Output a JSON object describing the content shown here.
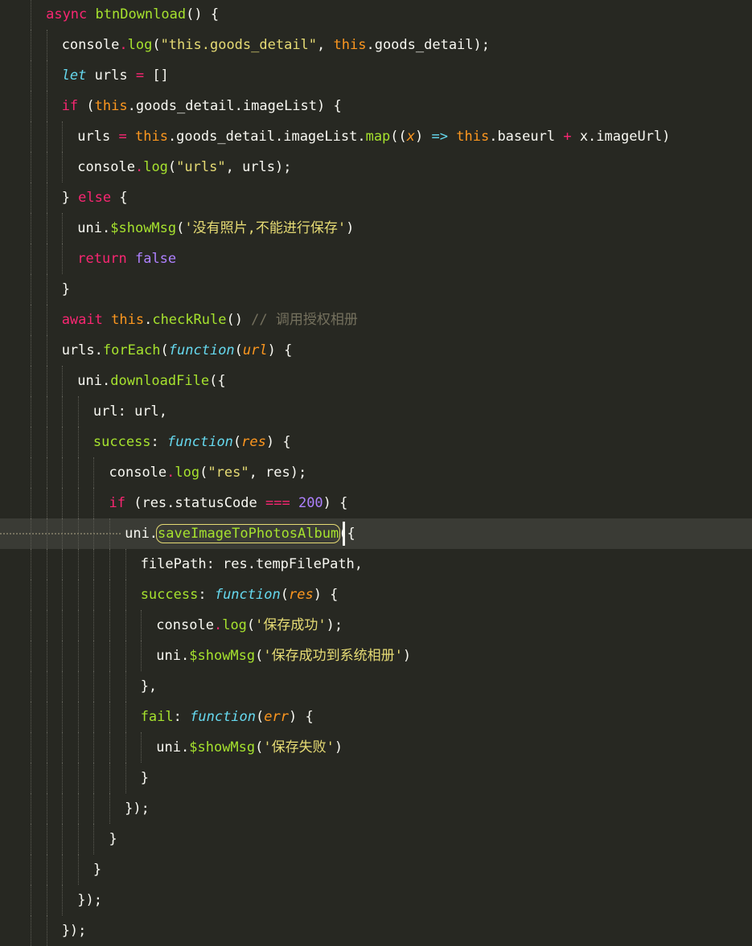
{
  "colors": {
    "background": "#272822",
    "text": "#f8f8f2",
    "keyword": "#f92672",
    "function": "#a6e22e",
    "string": "#e6db74",
    "number": "#ae81ff",
    "this": "#fd971f",
    "declaration": "#66d9ef",
    "comment": "#75715e",
    "active_line": "#3a3b35"
  },
  "active_line_index": 17,
  "highlighted_token": "saveImageToPhotosAlbum",
  "lines": [
    {
      "indent": 1,
      "tokens": [
        [
          "kw",
          "async "
        ],
        [
          "fn",
          "btnDownload"
        ],
        [
          "pl",
          "() {"
        ]
      ]
    },
    {
      "indent": 2,
      "tokens": [
        [
          "pl",
          "console"
        ],
        [
          "kw",
          "."
        ],
        [
          "fn",
          "log"
        ],
        [
          "pl",
          "("
        ],
        [
          "str",
          "\"this.goods_detail\""
        ],
        [
          "pl",
          ", "
        ],
        [
          "this",
          "this"
        ],
        [
          "pl",
          ".goods_detail);"
        ]
      ]
    },
    {
      "indent": 2,
      "tokens": [
        [
          "decl",
          "let"
        ],
        [
          "pl",
          " urls "
        ],
        [
          "kw",
          "="
        ],
        [
          "pl",
          " []"
        ]
      ]
    },
    {
      "indent": 2,
      "tokens": [
        [
          "kw",
          "if"
        ],
        [
          "pl",
          " ("
        ],
        [
          "this",
          "this"
        ],
        [
          "pl",
          ".goods_detail.imageList) {"
        ]
      ]
    },
    {
      "indent": 3,
      "tokens": [
        [
          "pl",
          "urls "
        ],
        [
          "kw",
          "="
        ],
        [
          "pl",
          " "
        ],
        [
          "this",
          "this"
        ],
        [
          "pl",
          ".goods_detail.imageList."
        ],
        [
          "fn",
          "map"
        ],
        [
          "pl",
          "(("
        ],
        [
          "param",
          "x"
        ],
        [
          "pl",
          ") "
        ],
        [
          "decl",
          "=>"
        ],
        [
          "pl",
          " "
        ],
        [
          "this",
          "this"
        ],
        [
          "pl",
          ".baseurl "
        ],
        [
          "kw",
          "+"
        ],
        [
          "pl",
          " x.imageUrl)"
        ]
      ]
    },
    {
      "indent": 3,
      "tokens": [
        [
          "pl",
          "console"
        ],
        [
          "kw",
          "."
        ],
        [
          "fn",
          "log"
        ],
        [
          "pl",
          "("
        ],
        [
          "str",
          "\"urls\""
        ],
        [
          "pl",
          ", urls);"
        ]
      ]
    },
    {
      "indent": 2,
      "tokens": [
        [
          "pl",
          "} "
        ],
        [
          "kw",
          "else"
        ],
        [
          "pl",
          " {"
        ]
      ]
    },
    {
      "indent": 3,
      "tokens": [
        [
          "pl",
          "uni."
        ],
        [
          "fn",
          "$showMsg"
        ],
        [
          "pl",
          "("
        ],
        [
          "str",
          "'没有照片,不能进行保存'"
        ],
        [
          "pl",
          ")"
        ]
      ]
    },
    {
      "indent": 3,
      "tokens": [
        [
          "kw",
          "return"
        ],
        [
          "pl",
          " "
        ],
        [
          "num",
          "false"
        ]
      ]
    },
    {
      "indent": 2,
      "tokens": [
        [
          "pl",
          "}"
        ]
      ]
    },
    {
      "indent": 2,
      "tokens": [
        [
          "kw",
          "await"
        ],
        [
          "pl",
          " "
        ],
        [
          "this",
          "this"
        ],
        [
          "pl",
          "."
        ],
        [
          "fn",
          "checkRule"
        ],
        [
          "pl",
          "() "
        ],
        [
          "cm",
          "// 调用授权相册"
        ]
      ]
    },
    {
      "indent": 2,
      "tokens": [
        [
          "pl",
          "urls."
        ],
        [
          "fn",
          "forEach"
        ],
        [
          "pl",
          "("
        ],
        [
          "decl",
          "function"
        ],
        [
          "pl",
          "("
        ],
        [
          "param",
          "url"
        ],
        [
          "pl",
          ") {"
        ]
      ]
    },
    {
      "indent": 3,
      "tokens": [
        [
          "pl",
          "uni."
        ],
        [
          "fn",
          "downloadFile"
        ],
        [
          "pl",
          "({"
        ]
      ]
    },
    {
      "indent": 4,
      "tokens": [
        [
          "pl",
          "url: url,"
        ]
      ]
    },
    {
      "indent": 4,
      "tokens": [
        [
          "fn",
          "success"
        ],
        [
          "pl",
          ": "
        ],
        [
          "decl",
          "function"
        ],
        [
          "pl",
          "("
        ],
        [
          "param",
          "res"
        ],
        [
          "pl",
          ") {"
        ]
      ]
    },
    {
      "indent": 5,
      "tokens": [
        [
          "pl",
          "console"
        ],
        [
          "kw",
          "."
        ],
        [
          "fn",
          "log"
        ],
        [
          "pl",
          "("
        ],
        [
          "str",
          "\"res\""
        ],
        [
          "pl",
          ", res);"
        ]
      ]
    },
    {
      "indent": 5,
      "tokens": [
        [
          "kw",
          "if"
        ],
        [
          "pl",
          " (res.statusCode "
        ],
        [
          "kw",
          "==="
        ],
        [
          "pl",
          " "
        ],
        [
          "num",
          "200"
        ],
        [
          "pl",
          ") {"
        ]
      ]
    },
    {
      "indent": 6,
      "tokens": [
        [
          "pl",
          "uni."
        ],
        [
          "fn",
          "saveImageToPhotosAlbum"
        ],
        [
          "pl",
          "({"
        ]
      ]
    },
    {
      "indent": 7,
      "tokens": [
        [
          "pl",
          "filePath: res.tempFilePath,"
        ]
      ]
    },
    {
      "indent": 7,
      "tokens": [
        [
          "fn",
          "success"
        ],
        [
          "pl",
          ": "
        ],
        [
          "decl",
          "function"
        ],
        [
          "pl",
          "("
        ],
        [
          "param",
          "res"
        ],
        [
          "pl",
          ") {"
        ]
      ]
    },
    {
      "indent": 8,
      "tokens": [
        [
          "pl",
          "console"
        ],
        [
          "kw",
          "."
        ],
        [
          "fn",
          "log"
        ],
        [
          "pl",
          "("
        ],
        [
          "str",
          "'保存成功'"
        ],
        [
          "pl",
          ");"
        ]
      ]
    },
    {
      "indent": 8,
      "tokens": [
        [
          "pl",
          "uni."
        ],
        [
          "fn",
          "$showMsg"
        ],
        [
          "pl",
          "("
        ],
        [
          "str",
          "'保存成功到系统相册'"
        ],
        [
          "pl",
          ")"
        ]
      ]
    },
    {
      "indent": 7,
      "tokens": [
        [
          "pl",
          "},"
        ]
      ]
    },
    {
      "indent": 7,
      "tokens": [
        [
          "fn",
          "fail"
        ],
        [
          "pl",
          ": "
        ],
        [
          "decl",
          "function"
        ],
        [
          "pl",
          "("
        ],
        [
          "param",
          "err"
        ],
        [
          "pl",
          ") {"
        ]
      ]
    },
    {
      "indent": 8,
      "tokens": [
        [
          "pl",
          "uni."
        ],
        [
          "fn",
          "$showMsg"
        ],
        [
          "pl",
          "("
        ],
        [
          "str",
          "'保存失败'"
        ],
        [
          "pl",
          ")"
        ]
      ]
    },
    {
      "indent": 7,
      "tokens": [
        [
          "pl",
          "}"
        ]
      ]
    },
    {
      "indent": 6,
      "tokens": [
        [
          "pl",
          "});"
        ]
      ]
    },
    {
      "indent": 5,
      "tokens": [
        [
          "pl",
          "}"
        ]
      ]
    },
    {
      "indent": 4,
      "tokens": [
        [
          "pl",
          "}"
        ]
      ]
    },
    {
      "indent": 3,
      "tokens": [
        [
          "pl",
          "});"
        ]
      ]
    },
    {
      "indent": 2,
      "tokens": [
        [
          "pl",
          "});"
        ]
      ]
    }
  ]
}
